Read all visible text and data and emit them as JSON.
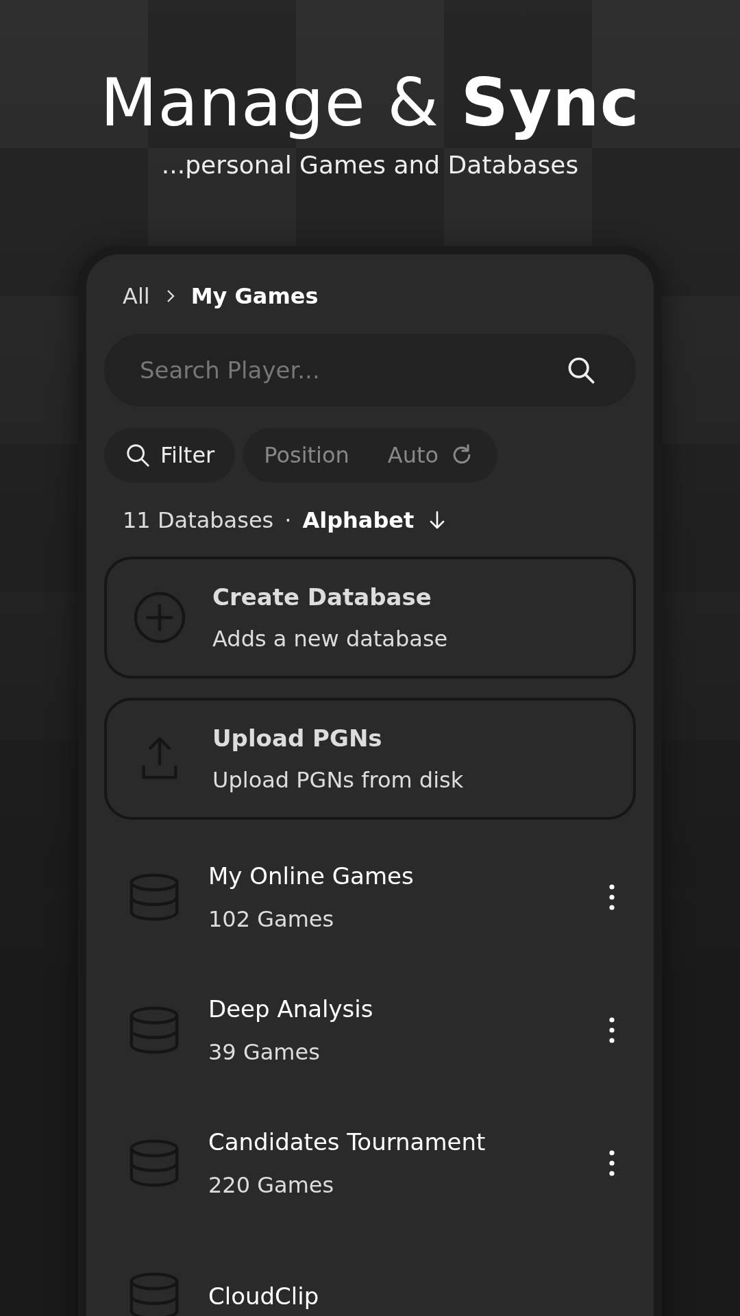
{
  "header": {
    "title": "Manage & **Sync**",
    "subtitle": "...personal Games and Databases"
  },
  "breadcrumb": [
    {
      "label": "All",
      "selected": false
    },
    {
      "label": "My Games",
      "selected": true
    }
  ],
  "search": {
    "placeholder": "Search Player..."
  },
  "filter": {
    "label": "Filter",
    "selected": true
  },
  "options": [
    {
      "label": "Position",
      "kind": "text"
    },
    {
      "label": "Auto",
      "kind": "refresh"
    }
  ],
  "summary": {
    "count": "11 Databases",
    "separator": "·",
    "sort": "Alphabet"
  },
  "actions": [
    {
      "kind": "create",
      "title": "Create Database",
      "subtitle": "Adds a new database"
    },
    {
      "kind": "upload",
      "title": "Upload PGNs",
      "subtitle": "Upload PGNs from disk"
    }
  ],
  "databases": [
    {
      "name": "My Online Games",
      "count": "102 Games"
    },
    {
      "name": "Deep Analysis",
      "count": "39 Games"
    },
    {
      "name": "Candidates Tournament",
      "count": "220 Games"
    },
    {
      "name": "CloudClip"
    }
  ]
}
